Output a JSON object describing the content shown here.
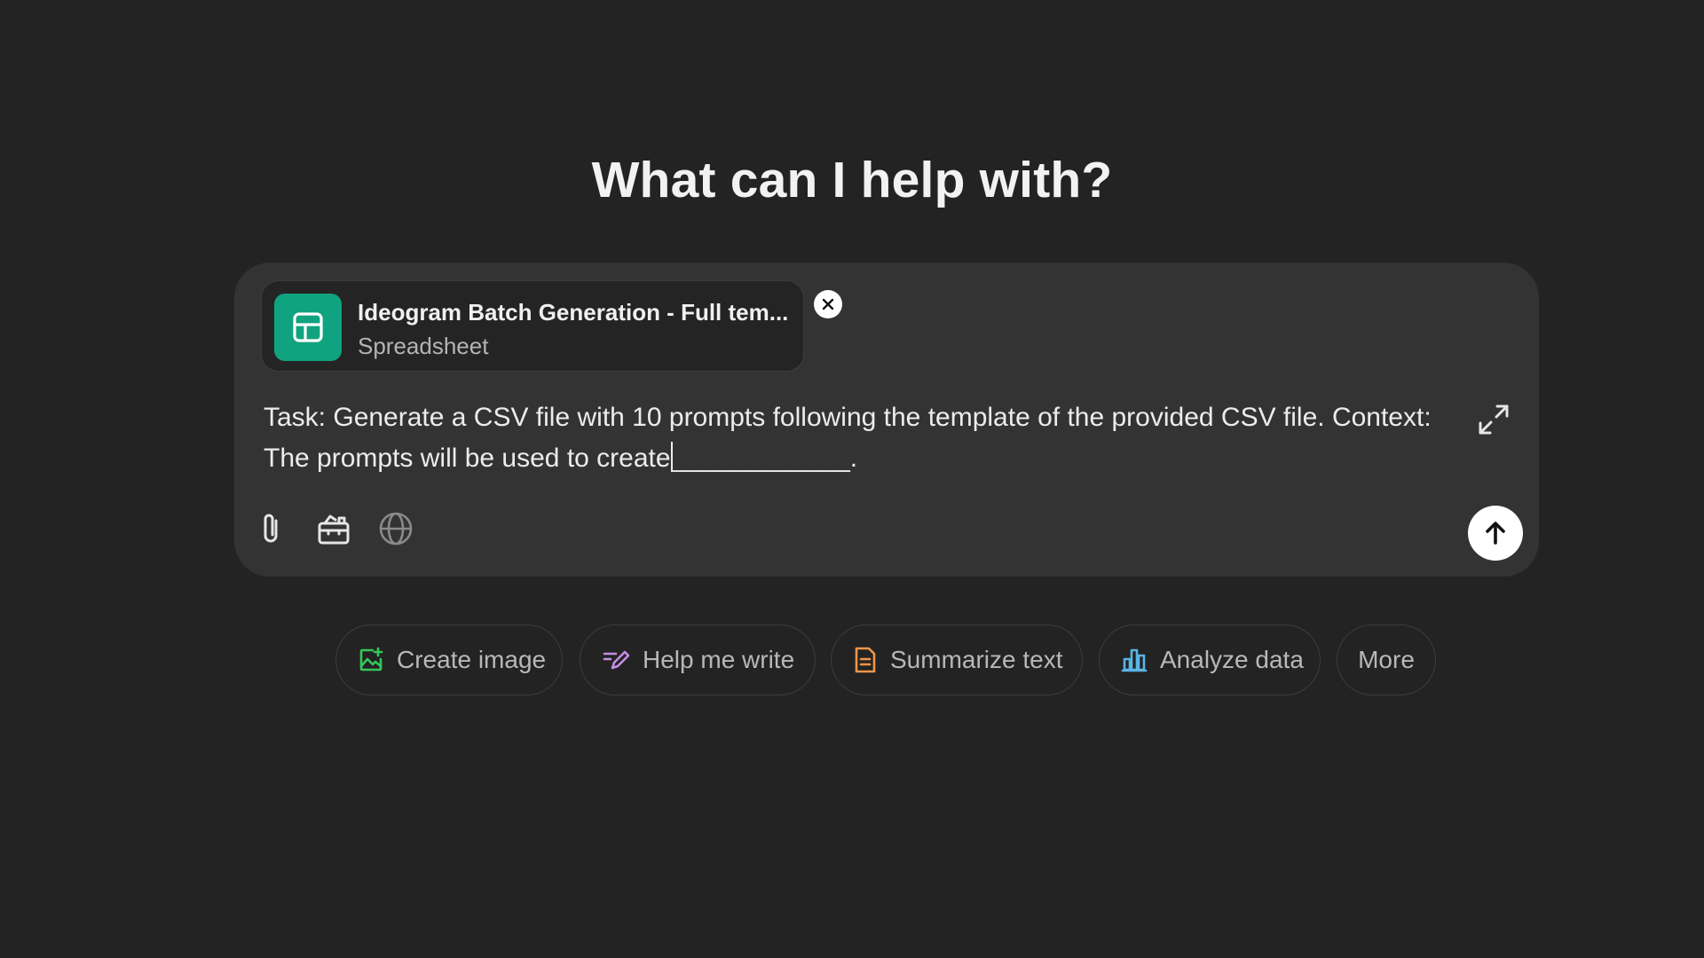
{
  "heading": "What can I help with?",
  "attachment": {
    "name": "Ideogram Batch Generation - Full tem...",
    "type": "Spreadsheet",
    "icon": "spreadsheet-icon",
    "icon_bg": "#10a37f"
  },
  "prompt": {
    "line1": "Task: Generate a CSV file with 10 prompts following the template of the provided CSV file. Context:",
    "line2_before": "The prompts will be used to create",
    "line2_blank": "____________",
    "line2_after": "."
  },
  "toolbar": {
    "attach": "paperclip-icon",
    "tools": "toolbox-icon",
    "search": "globe-icon",
    "send": "arrow-up-icon",
    "expand": "expand-icon"
  },
  "suggestions": [
    {
      "label": "Create image",
      "icon": "image-icon",
      "color": "#34c759"
    },
    {
      "label": "Help me write",
      "icon": "pen-icon",
      "color": "#c58ee6"
    },
    {
      "label": "Summarize text",
      "icon": "document-icon",
      "color": "#f0954a"
    },
    {
      "label": "Analyze data",
      "icon": "bar-chart-icon",
      "color": "#5ab4e6"
    },
    {
      "label": "More",
      "icon": "",
      "color": ""
    }
  ]
}
